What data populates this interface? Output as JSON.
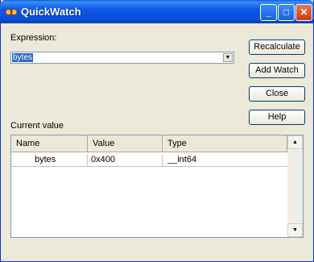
{
  "window": {
    "title": "QuickWatch"
  },
  "expression": {
    "label": "Expression:",
    "value": "bytes"
  },
  "buttons": {
    "recalculate": "Recalculate",
    "add_watch": "Add Watch",
    "close": "Close",
    "help": "Help"
  },
  "current_value": {
    "label": "Current value"
  },
  "grid": {
    "headers": [
      "Name",
      "Value",
      "Type"
    ],
    "rows": [
      {
        "name": "bytes",
        "value": "0x400",
        "type": "__int64"
      }
    ]
  }
}
